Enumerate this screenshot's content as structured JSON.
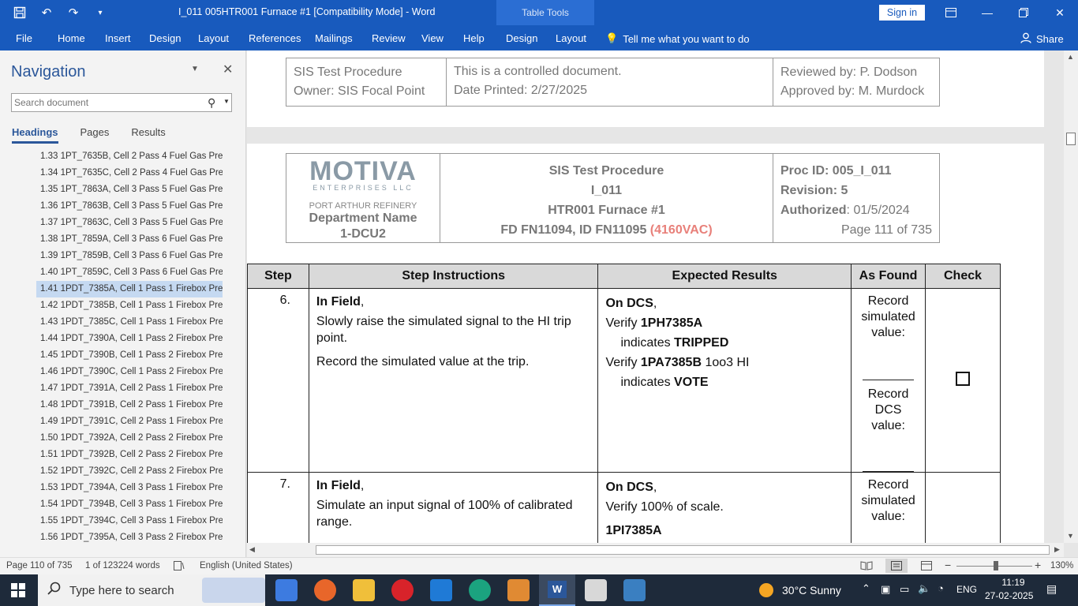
{
  "window": {
    "title": "I_011 005HTR001 Furnace #1 [Compatibility Mode] - Word",
    "table_tools": "Table Tools",
    "sign_in": "Sign in"
  },
  "ribbon": {
    "tabs": [
      "File",
      "Home",
      "Insert",
      "Design",
      "Layout",
      "References",
      "Mailings",
      "Review",
      "View",
      "Help",
      "Design",
      "Layout"
    ],
    "tell_me": "Tell me what you want to do",
    "share": "Share"
  },
  "navigation": {
    "title": "Navigation",
    "search_placeholder": "Search document",
    "tabs": [
      "Headings",
      "Pages",
      "Results"
    ],
    "active_tab": "Headings",
    "headings": [
      "1.33 1PT_7635B, Cell 2 Pass 4 Fuel Gas Pre...",
      "1.34 1PT_7635C, Cell 2 Pass 4 Fuel Gas Pre...",
      "1.35 1PT_7863A, Cell 3 Pass 5 Fuel Gas Pre...",
      "1.36 1PT_7863B, Cell 3 Pass 5 Fuel Gas Pre...",
      "1.37 1PT_7863C, Cell 3 Pass 5 Fuel Gas Pre...",
      "1.38 1PT_7859A, Cell 3 Pass 6 Fuel Gas Pre...",
      "1.39 1PT_7859B, Cell 3 Pass 6 Fuel Gas Pre...",
      "1.40 1PT_7859C, Cell 3 Pass 6 Fuel Gas Pre...",
      "1.41 1PDT_7385A, Cell 1 Pass 1 Firebox Pre...",
      "1.42 1PDT_7385B, Cell 1 Pass 1 Firebox Pre...",
      "1.43 1PDT_7385C, Cell 1 Pass 1 Firebox Pre...",
      "1.44 1PDT_7390A, Cell 1 Pass 2 Firebox Pre...",
      "1.45 1PDT_7390B, Cell 1 Pass 2 Firebox Pre...",
      "1.46 1PDT_7390C, Cell 1 Pass 2 Firebox Pre...",
      "1.47 1PDT_7391A, Cell 2 Pass 1 Firebox Pre...",
      "1.48 1PDT_7391B, Cell 2 Pass 1 Firebox Pre...",
      "1.49 1PDT_7391C, Cell 2 Pass 1 Firebox Pre...",
      "1.50 1PDT_7392A, Cell 2 Pass 2 Firebox Pre...",
      "1.51 1PDT_7392B, Cell 2 Pass 2 Firebox Pre...",
      "1.52 1PDT_7392C, Cell 2 Pass 2 Firebox Pre...",
      "1.53 1PDT_7394A, Cell 3 Pass 1 Firebox Pre...",
      "1.54 1PDT_7394B, Cell 3 Pass 1 Firebox Pre...",
      "1.55 1PDT_7394C, Cell 3 Pass 1 Firebox Pre...",
      "1.56 1PDT_7395A, Cell 3 Pass 2 Firebox Pre..."
    ],
    "selected_index": 8
  },
  "page1_header": {
    "left1": "SIS Test Procedure",
    "left2": "Owner: SIS Focal Point",
    "mid1": "This is a controlled document.",
    "mid2": "Date Printed: 2/27/2025",
    "right1": "Reviewed by: P. Dodson",
    "right2": "Approved by: M. Murdock"
  },
  "page2_header": {
    "logo": "MOTIVA",
    "logo_sub": "ENTERPRISES LLC",
    "refinery": "PORT ARTHUR REFINERY",
    "dept1": "Department Name",
    "dept2": "1-DCU2",
    "title1": "SIS Test Procedure",
    "title2": "I_011",
    "title3": "HTR001 Furnace #1",
    "title4": "FD FN11094, ID FN11095",
    "title4_red": "(4160VAC)",
    "proc_id": "Proc ID: 005_I_011",
    "revision": "Revision: 5",
    "authorized_label": "Authorized",
    "authorized_value": ": 01/5/2024",
    "page": "Page 111 of 735"
  },
  "steps_table": {
    "headers": [
      "Step",
      "Step Instructions",
      "Expected Results",
      "As Found",
      "Check"
    ],
    "rows": [
      {
        "step": "6.",
        "instr_title": "In Field",
        "instr_lines": [
          "Slowly raise the simulated signal to the HI trip point.",
          "Record the simulated value at the trip."
        ],
        "exp_title": "On DCS",
        "exp_verify1": "Verify ",
        "exp_tag1": "1PH7385A",
        "exp_ind1": "indicates ",
        "exp_state1": "TRIPPED",
        "exp_verify2": "Verify ",
        "exp_tag2": "1PA7385B",
        "exp_vote": " 1oo3 HI",
        "exp_ind2": "indicates ",
        "exp_state2": "VOTE",
        "found1": "Record simulated value:",
        "found2": "Record DCS value:"
      },
      {
        "step": "7.",
        "instr_title": "In Field",
        "instr_lines": [
          "Simulate an input signal of 100% of calibrated range."
        ],
        "exp_title": "On DCS",
        "exp_verify": "Verify 100% of scale.",
        "exp_tag": "1PI7385A",
        "found1": "Record simulated value:"
      }
    ]
  },
  "status": {
    "page": "Page 110 of 735",
    "words": "1 of 123224 words",
    "language": "English (United States)",
    "zoom": "130%"
  },
  "taskbar": {
    "search_placeholder": "Type here to search",
    "weather": "30°C  Sunny",
    "lang": "ENG",
    "time": "11:19",
    "date": "27-02-2025"
  }
}
